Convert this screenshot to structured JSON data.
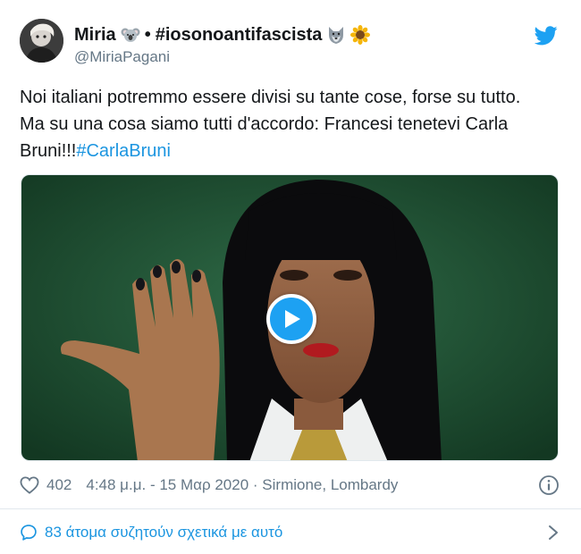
{
  "tweet": {
    "author": {
      "display_name": "Miria",
      "separator": "•",
      "tag": "#iosonoantifascista",
      "handle": "@MiriaPagani",
      "avatar_icon": "avatar-icon"
    },
    "text": {
      "line1": "Noi italiani potremmo essere divisi su tante cose, forse su tutto.",
      "line2": "Ma su una cosa  siamo tutti d'accordo: Francesi tenetevi Carla",
      "line3": "Bruni!!!",
      "hashtag": "#CarlaBruni"
    },
    "media": {
      "type": "video",
      "play_icon": "play-icon"
    },
    "meta": {
      "likes": "402",
      "timestamp": "4:48 μ.μ. - 15 Μαρ 2020",
      "location": "· Sirmione, Lombardy"
    },
    "footer": {
      "conversation_text": "83 άτομα συζητούν σχετικά με αυτό"
    },
    "colors": {
      "accent": "#1b95e0",
      "twitter_blue": "#1da1f2",
      "text": "#14171a",
      "muted": "#657786",
      "border": "#e1e8ed"
    }
  }
}
